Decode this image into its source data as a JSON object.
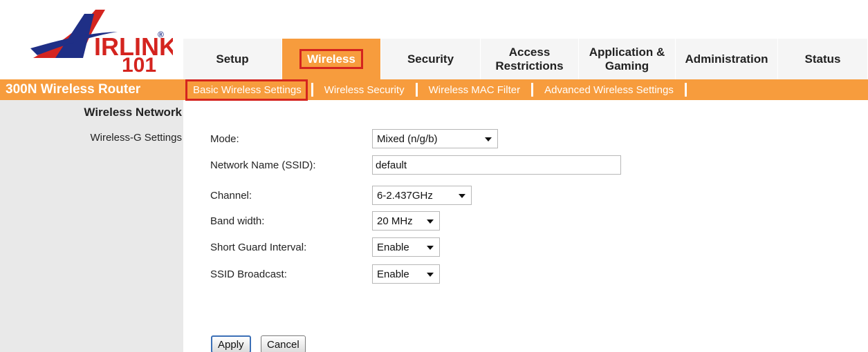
{
  "logo": {
    "brand": "AirLink",
    "model_number": "101",
    "registered_mark": "®",
    "red": "#d4241f",
    "blue": "#1f2f86"
  },
  "top_tabs": [
    {
      "label": "Setup",
      "active": false
    },
    {
      "label": "Wireless",
      "active": true
    },
    {
      "label": "Security",
      "active": false
    },
    {
      "label": "Access Restrictions",
      "active": false
    },
    {
      "label": "Application & Gaming",
      "active": false
    },
    {
      "label": "Administration",
      "active": false
    },
    {
      "label": "Status",
      "active": false
    }
  ],
  "product_name": "300N Wireless Router",
  "sub_nav": [
    {
      "label": "Basic Wireless Settings",
      "active": true
    },
    {
      "label": "Wireless Security",
      "active": false
    },
    {
      "label": "Wireless MAC Filter",
      "active": false
    },
    {
      "label": "Advanced Wireless Settings",
      "active": false
    }
  ],
  "left": {
    "section_title": "Wireless Network",
    "section_subtitle": "Wireless-G Settings"
  },
  "form": {
    "mode": {
      "label": "Mode:",
      "value": "Mixed (n/g/b)"
    },
    "ssid": {
      "label": "Network Name (SSID):",
      "value": "default"
    },
    "channel": {
      "label": "Channel:",
      "value": "6-2.437GHz"
    },
    "bandwidth": {
      "label": "Band width:",
      "value": "20 MHz"
    },
    "short_guard": {
      "label": "Short Guard Interval:",
      "value": "Enable"
    },
    "ssid_broadcast": {
      "label": "SSID Broadcast:",
      "value": "Enable"
    }
  },
  "buttons": {
    "apply": "Apply",
    "cancel": "Cancel"
  },
  "colors": {
    "accent_orange": "#f79c3d",
    "highlight_red": "#d4241f",
    "sidebar_gray": "#e9e9e9"
  }
}
